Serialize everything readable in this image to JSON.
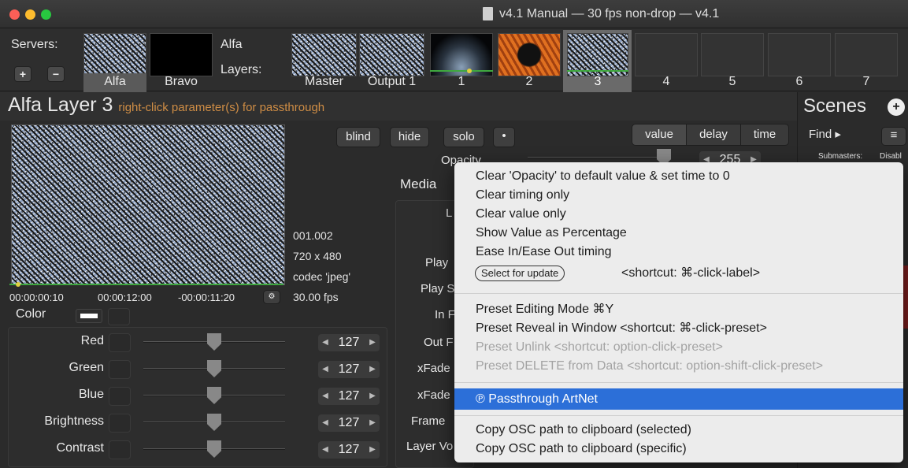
{
  "window": {
    "title": "v4.1 Manual  —  30 fps non-drop  —  v4.1"
  },
  "servers": {
    "label": "Servers:",
    "items": [
      "Alfa",
      "Bravo"
    ],
    "add_label": "+",
    "remove_label": "−"
  },
  "layers": {
    "server_name": "Alfa",
    "label": "Layers:",
    "items": [
      "Master",
      "Output 1",
      "1",
      "2",
      "3",
      "4",
      "5",
      "6",
      "7"
    ],
    "selected": "3"
  },
  "layer_panel": {
    "title": "Alfa Layer 3",
    "hint": "right-click parameter(s) for passthrough",
    "buttons": {
      "blind": "blind",
      "hide": "hide",
      "solo": "solo"
    },
    "mode_tabs": [
      "value",
      "delay",
      "time"
    ],
    "opacity_label": "Opacity",
    "opacity_value": "255",
    "media_label": "Media",
    "clip_info": {
      "index": "001.002",
      "resolution": "720 x 480",
      "codec": "codec 'jpeg'",
      "fps": "30.00 fps"
    },
    "timecodes": {
      "current": "00:00:00:10",
      "duration": "00:00:12:00",
      "remaining": "-00:00:11:20"
    },
    "color": {
      "label": "Color",
      "swatch_color": "#ffffff",
      "sliders": [
        {
          "label": "Red",
          "value": "127",
          "level": 0.5
        },
        {
          "label": "Green",
          "value": "127",
          "level": 0.5
        },
        {
          "label": "Blue",
          "value": "127",
          "level": 0.5
        },
        {
          "label": "Brightness",
          "value": "127",
          "level": 0.5
        },
        {
          "label": "Contrast",
          "value": "127",
          "level": 0.5
        }
      ]
    },
    "media_params": [
      "L",
      "Play",
      "Play S",
      "In F",
      "Out F",
      "xFade",
      "xFade",
      "Frame",
      "Layer Vo"
    ]
  },
  "scenes": {
    "title": "Scenes",
    "add_label": "+",
    "find_label": "Find ▸",
    "submasters_label": "Submasters:",
    "submasters_value": "Disabl"
  },
  "context_menu": {
    "items": [
      {
        "label": "Clear 'Opacity' to default value & set time to 0",
        "disabled": false
      },
      {
        "label": "Clear timing only",
        "disabled": false
      },
      {
        "label": "Clear value only",
        "disabled": false
      },
      {
        "label": "Show Value as Percentage",
        "disabled": false
      },
      {
        "label": "Ease In/Ease Out timing",
        "disabled": false
      }
    ],
    "select_for_update": "Select for update",
    "select_shortcut": "<shortcut: ⌘-click-label>",
    "group2": [
      {
        "label": "Preset Editing Mode  ⌘Y",
        "disabled": false
      },
      {
        "label": "Preset Reveal in Window  <shortcut: ⌘-click-preset>",
        "disabled": false
      },
      {
        "label": "Preset Unlink       <shortcut: option-click-preset>",
        "disabled": true
      },
      {
        "label": "Preset DELETE from Data <shortcut: option-shift-click-preset>",
        "disabled": true
      }
    ],
    "passthrough": "℗ Passthrough ArtNet",
    "group3": [
      {
        "label": "Copy OSC path to clipboard (selected)",
        "disabled": false
      },
      {
        "label": "Copy OSC path to clipboard (specific)",
        "disabled": false
      }
    ]
  },
  "colors": {
    "accent": "#cf8d45",
    "highlight": "#2c6fd8",
    "timeline": "#3fa83f",
    "selected_layer": "#6a6a6a"
  }
}
